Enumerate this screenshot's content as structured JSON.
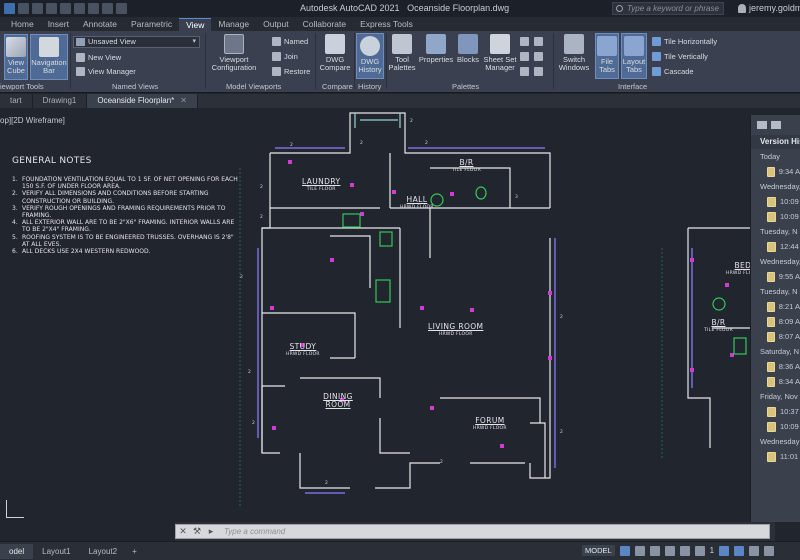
{
  "app": {
    "title": "Autodesk AutoCAD 2021",
    "document": "Oceanside Floorplan.dwg",
    "search_placeholder": "Type a keyword or phrase",
    "user": "jeremy.goldm"
  },
  "ribbon_tabs": [
    "Home",
    "Insert",
    "Annotate",
    "Parametric",
    "View",
    "Manage",
    "Output",
    "Collaborate",
    "Express Tools"
  ],
  "active_ribbon_tab": "View",
  "ribbon": {
    "view_cube": "View Cube",
    "navigation_bar": "Navigation Bar",
    "view_dropdown": "Unsaved View",
    "new_view": "New View",
    "view_manager": "View Manager",
    "viewport_configuration": "Viewport Configuration",
    "named": "Named",
    "join": "Join",
    "restore": "Restore",
    "dwg_compare": "DWG Compare",
    "dwg_history": "DWG History",
    "tool_palettes": "Tool Palettes",
    "properties": "Properties",
    "blocks": "Blocks",
    "sheet_set_manager": "Sheet Set Manager",
    "switch_windows": "Switch Windows",
    "file_tabs": "File Tabs",
    "layout_tabs": "Layout Tabs",
    "tile_horizontally": "Tile Horizontally",
    "tile_vertically": "Tile Vertically",
    "cascade": "Cascade"
  },
  "panel_labels": {
    "viewport_tools": "iewport Tools",
    "named_views": "Named Views",
    "model_viewports": "Model Viewports",
    "compare": "Compare",
    "history": "History",
    "palettes": "Palettes",
    "interface": "Interface"
  },
  "doc_tabs": [
    {
      "label": "tart",
      "active": false
    },
    {
      "label": "Drawing1",
      "active": false
    },
    {
      "label": "Oceanside Floorplan*",
      "active": true
    }
  ],
  "viewport_label": "op][2D Wireframe]",
  "general_notes": {
    "title": "GENERAL NOTES",
    "items": [
      {
        "num": "1.",
        "text": "FOUNDATION VENTILATION EQUAL TO 1 SF. OF NET OPENING FOR EACH 150 S.F. OF UNDER FLOOR AREA."
      },
      {
        "num": "2.",
        "text": "VERIFY ALL DIMENSIONS AND CONDITIONS BEFORE STARTING CONSTRUCTION OR BUILDING."
      },
      {
        "num": "3.",
        "text": "VERIFY ROUGH OPENINGS AND FRAMING REQUIREMENTS PRIOR TO FRAMING."
      },
      {
        "num": "4.",
        "text": "ALL EXTERIOR WALL ARE TO BE 2\"X6\" FRAMING. INTERIOR WALLS ARE TO BE 2\"X4\" FRAMING."
      },
      {
        "num": "5.",
        "text": "ROOFING SYSTEM IS TO BE ENGINEERED TRUSSES. OVERHANG IS 2'8\" AT ALL EVES."
      },
      {
        "num": "6.",
        "text": "ALL DECKS USE 2X4 WESTERN REDWOOD."
      }
    ]
  },
  "rooms": {
    "laundry": {
      "name": "LAUNDRY",
      "sub": "TILE FLOOR"
    },
    "bath": {
      "name": "B/R",
      "sub": "TILE FLOOR"
    },
    "hall": {
      "name": "HALL",
      "sub": "HRWD FLOOR"
    },
    "living": {
      "name": "LIVING ROOM",
      "sub": "HRWD FLOOR"
    },
    "study": {
      "name": "STUDY",
      "sub": "HRWD FLOOR"
    },
    "dining": {
      "name": "DINING ROOM",
      "sub": ""
    },
    "forum": {
      "name": "FORUM",
      "sub": "HRWD FLOOR"
    },
    "bed": {
      "name": "BED",
      "sub": "HRWD FLOOR"
    },
    "bath2": {
      "name": "B/R",
      "sub": "TILE FLOOR"
    }
  },
  "version_history": {
    "title": "Version His",
    "groups": [
      {
        "label": "Today",
        "entries": [
          "9:34 A"
        ]
      },
      {
        "label": "Wednesday,",
        "entries": [
          "10:09",
          "10:09"
        ]
      },
      {
        "label": "Tuesday, N",
        "entries": [
          "12:44"
        ]
      },
      {
        "label": "Wednesday,",
        "entries": [
          "9:55 A"
        ]
      },
      {
        "label": "Tuesday, N",
        "entries": [
          "8:21 A",
          "8:09 A",
          "8:07 A"
        ]
      },
      {
        "label": "Saturday, N",
        "entries": [
          "8:36 A",
          "8:34 A"
        ]
      },
      {
        "label": "Friday, Nov",
        "entries": [
          "10:37",
          "10:09"
        ]
      },
      {
        "label": "Wednesday",
        "entries": [
          "11:01"
        ]
      }
    ]
  },
  "command_line": {
    "placeholder": "Type a command"
  },
  "layout_tabs": [
    {
      "label": "odel",
      "active": true
    },
    {
      "label": "Layout1",
      "active": false
    },
    {
      "label": "Layout2",
      "active": false
    }
  ],
  "status": {
    "model": "MODEL",
    "scale": "1"
  }
}
